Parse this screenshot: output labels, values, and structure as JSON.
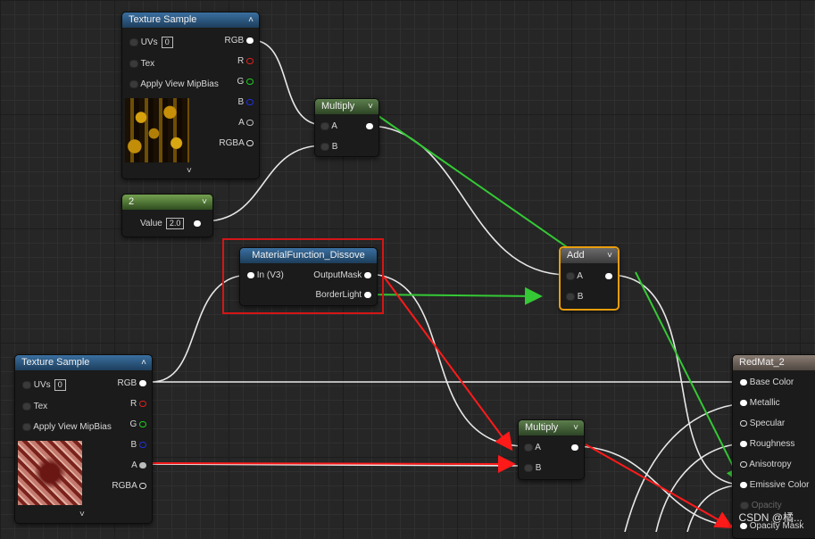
{
  "texture_sample_1": {
    "title": "Texture Sample",
    "inputs": [
      "UVs",
      "Tex",
      "Apply View MipBias"
    ],
    "uvs_value": "0",
    "outputs": [
      "RGB",
      "R",
      "G",
      "B",
      "A",
      "RGBA"
    ]
  },
  "multiply_1": {
    "title": "Multiply",
    "inputs": [
      "A",
      "B"
    ]
  },
  "constant": {
    "title": "2",
    "value_label": "Value",
    "value": "2.0"
  },
  "material_function": {
    "title": "MaterialFunction_Dissove",
    "input": "In (V3)",
    "outputs": [
      "OutputMask",
      "BorderLight"
    ]
  },
  "add": {
    "title": "Add",
    "inputs": [
      "A",
      "B"
    ]
  },
  "texture_sample_2": {
    "title": "Texture Sample",
    "inputs": [
      "UVs",
      "Tex",
      "Apply View MipBias"
    ],
    "uvs_value": "0",
    "outputs": [
      "RGB",
      "R",
      "G",
      "B",
      "A",
      "RGBA"
    ]
  },
  "multiply_2": {
    "title": "Multiply",
    "inputs": [
      "A",
      "B"
    ]
  },
  "result": {
    "title": "RedMat_2",
    "inputs": [
      "Base Color",
      "Metallic",
      "Specular",
      "Roughness",
      "Anisotropy",
      "Emissive Color",
      "Opacity",
      "Opacity Mask"
    ]
  },
  "icons": [
    "chevron-up-icon",
    "chevron-down-icon"
  ],
  "colors": {
    "red_pin": "#e02020",
    "green_pin": "#1fcf1f",
    "blue_pin": "#2030e0",
    "highlight_red": "#d41616",
    "arrow_green": "#35c935",
    "selection_orange": "#e99d0d"
  },
  "watermark": "CSDN @橘..."
}
